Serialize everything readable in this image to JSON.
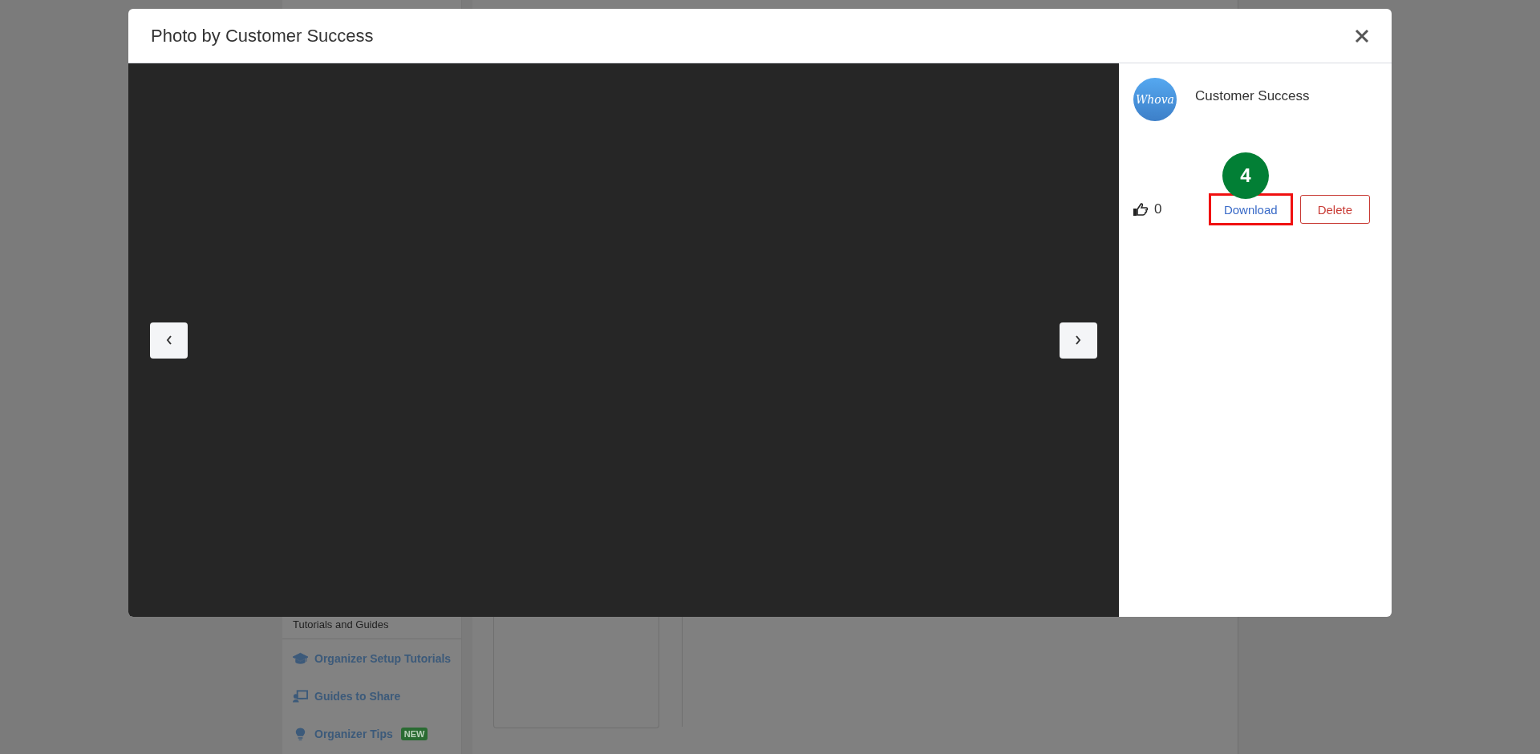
{
  "background": {
    "sidebar": {
      "section_label": "Tutorials and Guides",
      "items": [
        {
          "kind": "graduation",
          "label": "Organizer Setup Tutorials"
        },
        {
          "kind": "presenter",
          "label": "Guides to Share"
        },
        {
          "kind": "bulb",
          "label": "Organizer Tips",
          "badge": "NEW"
        }
      ]
    }
  },
  "modal": {
    "title": "Photo by Customer Success",
    "author": {
      "avatar_text": "Whova",
      "name": "Customer Success"
    },
    "likes": "0",
    "actions": [
      {
        "kind": "download",
        "label": "Download",
        "highlighted": true
      },
      {
        "kind": "delete",
        "label": "Delete",
        "highlighted": false
      }
    ],
    "step_marker": "4"
  }
}
